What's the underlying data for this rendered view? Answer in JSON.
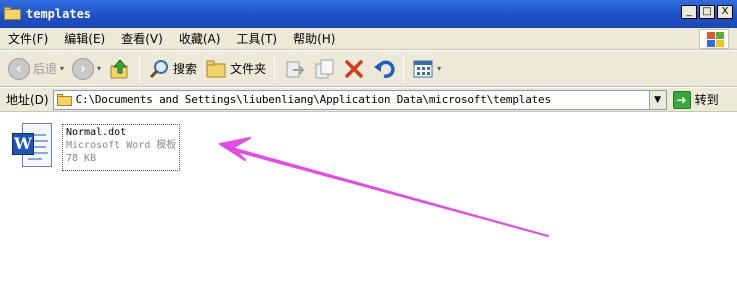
{
  "window": {
    "title": "templates",
    "min_label": "_",
    "max_label": "□",
    "close_label": "X"
  },
  "menu": {
    "items": [
      "文件(F)",
      "编辑(E)",
      "查看(V)",
      "收藏(A)",
      "工具(T)",
      "帮助(H)"
    ]
  },
  "toolbar": {
    "back_label": "后退",
    "search_label": "搜索",
    "folders_label": "文件夹"
  },
  "address": {
    "label": "地址(D)",
    "path": "C:\\Documents and Settings\\liubenliang\\Application Data\\microsoft\\templates",
    "go_label": "转到"
  },
  "files": [
    {
      "name": "Normal.dot",
      "type": "Microsoft Word 模板",
      "size": "78 KB",
      "icon": "word-document-icon"
    }
  ],
  "annotation": {
    "arrow_color": "#e64ae6"
  }
}
